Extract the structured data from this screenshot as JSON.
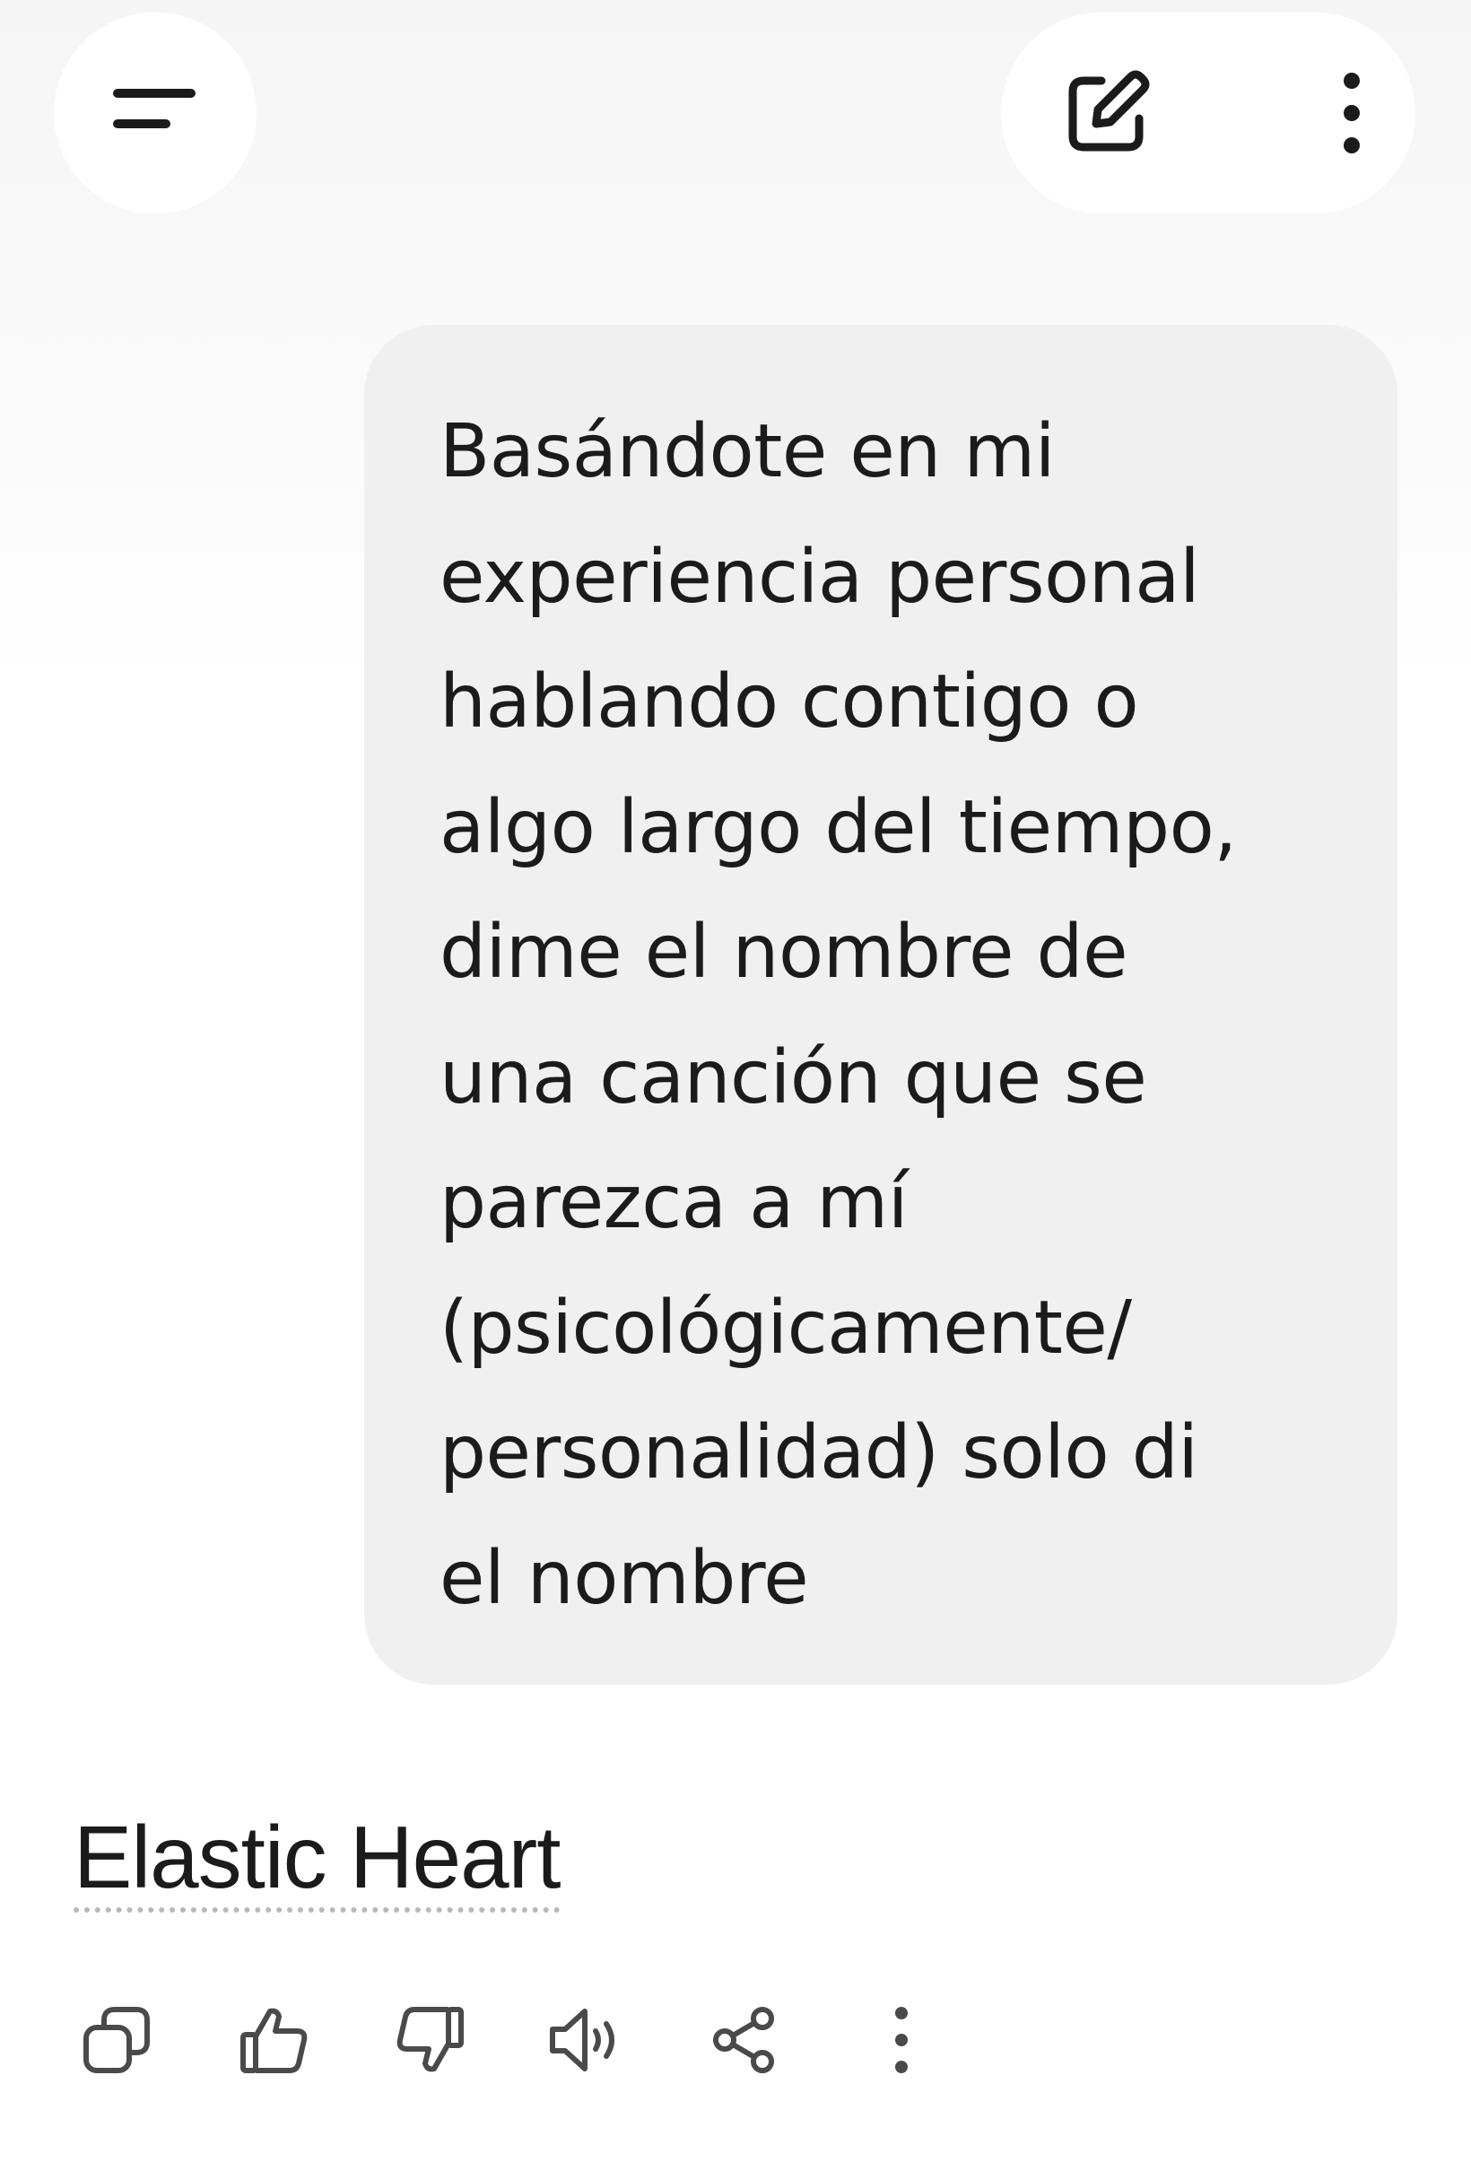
{
  "header": {
    "menu_icon": "menu-lines-icon",
    "new_chat_icon": "edit-pencil-icon",
    "more_icon": "vertical-dots-icon"
  },
  "conversation": {
    "prompt": "Basándote en mi\nexperiencia personal\nhablando contigo o\nalgo largo del tiempo,\ndime el nombre de\nuna canción que se\nparezca a mí\n(psicológicamente/\npersonalidad) solo di\nel nombre",
    "response": "Elastic Heart"
  },
  "actions": [
    {
      "icon": "copy-icon"
    },
    {
      "icon": "thumbs-up-icon"
    },
    {
      "icon": "thumbs-down-icon"
    },
    {
      "icon": "speaker-icon"
    },
    {
      "icon": "share-icon"
    },
    {
      "icon": "more-vertical-icon"
    }
  ],
  "colors": {
    "text": "#1b1b1b",
    "bubble": "#f0f0f0",
    "icon": "#4a4a4a",
    "pill": "#ffffff"
  }
}
